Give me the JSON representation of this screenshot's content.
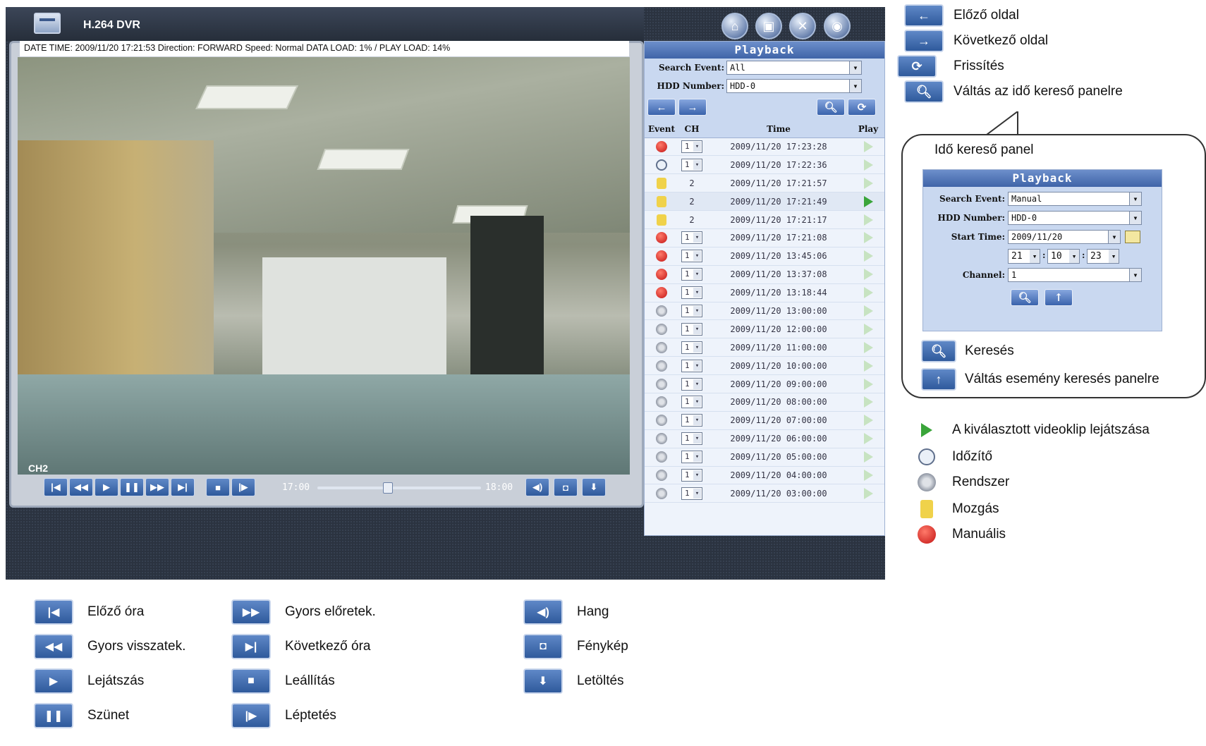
{
  "app": {
    "title": "H.264 DVR"
  },
  "video": {
    "info": "DATE TIME: 2009/11/20 17:21:53      Direction: FORWARD  Speed: Normal  DATA LOAD: 1% / PLAY LOAD: 14%",
    "camera_label": "CH2",
    "time_start": "17:00",
    "time_end": "18:00",
    "slider_position": 0.4
  },
  "playback": {
    "title": "Playback",
    "search_event_label": "Search Event:",
    "search_event_value": "All",
    "hdd_label": "HDD Number:",
    "hdd_value": "HDD-0",
    "columns": [
      "Event",
      "CH",
      "Time",
      "Play"
    ],
    "rows": [
      {
        "type": "manual",
        "ch": "1",
        "ch_select": true,
        "time": "2009/11/20 17:23:28"
      },
      {
        "type": "timer",
        "ch": "1",
        "ch_select": true,
        "time": "2009/11/20 17:22:36"
      },
      {
        "type": "motion",
        "ch": "2",
        "ch_select": false,
        "time": "2009/11/20 17:21:57"
      },
      {
        "type": "motion",
        "ch": "2",
        "ch_select": false,
        "time": "2009/11/20 17:21:49",
        "selected": true
      },
      {
        "type": "motion",
        "ch": "2",
        "ch_select": false,
        "time": "2009/11/20 17:21:17"
      },
      {
        "type": "manual",
        "ch": "1",
        "ch_select": true,
        "time": "2009/11/20 17:21:08"
      },
      {
        "type": "manual",
        "ch": "1",
        "ch_select": true,
        "time": "2009/11/20 13:45:06"
      },
      {
        "type": "manual",
        "ch": "1",
        "ch_select": true,
        "time": "2009/11/20 13:37:08"
      },
      {
        "type": "manual",
        "ch": "1",
        "ch_select": true,
        "time": "2009/11/20 13:18:44"
      },
      {
        "type": "system",
        "ch": "1",
        "ch_select": true,
        "time": "2009/11/20 13:00:00"
      },
      {
        "type": "system",
        "ch": "1",
        "ch_select": true,
        "time": "2009/11/20 12:00:00"
      },
      {
        "type": "system",
        "ch": "1",
        "ch_select": true,
        "time": "2009/11/20 11:00:00"
      },
      {
        "type": "system",
        "ch": "1",
        "ch_select": true,
        "time": "2009/11/20 10:00:00"
      },
      {
        "type": "system",
        "ch": "1",
        "ch_select": true,
        "time": "2009/11/20 09:00:00"
      },
      {
        "type": "system",
        "ch": "1",
        "ch_select": true,
        "time": "2009/11/20 08:00:00"
      },
      {
        "type": "system",
        "ch": "1",
        "ch_select": true,
        "time": "2009/11/20 07:00:00"
      },
      {
        "type": "system",
        "ch": "1",
        "ch_select": true,
        "time": "2009/11/20 06:00:00"
      },
      {
        "type": "system",
        "ch": "1",
        "ch_select": true,
        "time": "2009/11/20 05:00:00"
      },
      {
        "type": "system",
        "ch": "1",
        "ch_select": true,
        "time": "2009/11/20 04:00:00"
      },
      {
        "type": "system",
        "ch": "1",
        "ch_select": true,
        "time": "2009/11/20 03:00:00"
      }
    ]
  },
  "legend_top": {
    "prev_page": "Előző oldal",
    "next_page": "Következő oldal",
    "refresh": "Frissítés",
    "switch_time_search": "Váltás az idő kereső panelre"
  },
  "time_search": {
    "heading": "Idő kereső panel",
    "title": "Playback",
    "search_event_label": "Search Event:",
    "search_event_value": "Manual",
    "hdd_label": "HDD Number:",
    "hdd_value": "HDD-0",
    "start_time_label": "Start Time:",
    "start_date": "2009/11/20",
    "hour": "21",
    "minute": "10",
    "second": "23",
    "channel_label": "Channel:",
    "channel_value": "1",
    "search_caption": "Keresés",
    "switch_event_caption": "Váltás esemény keresés panelre"
  },
  "legend_status": {
    "play_selected": "A kiválasztott videoklip lejátszása",
    "timer": "Időzítő",
    "system": "Rendszer",
    "motion": "Mozgás",
    "manual": "Manuális"
  },
  "legend_bottom": {
    "prev_hour": "Előző óra",
    "rewind": "Gyors visszatek.",
    "play": "Lejátszás",
    "pause": "Szünet",
    "fast_forward": "Gyors előretek.",
    "next_hour": "Következő óra",
    "stop": "Leállítás",
    "step": "Léptetés",
    "audio": "Hang",
    "snapshot": "Fénykép",
    "download": "Letöltés"
  },
  "colors": {
    "accent": "#3a63ac",
    "play_active": "#3aa53a",
    "manual_event": "#c31414"
  }
}
